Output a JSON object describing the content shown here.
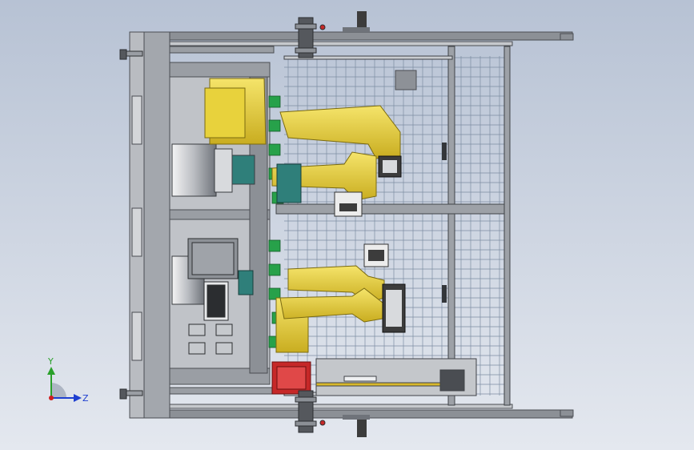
{
  "viewport": {
    "background_top": "#b7c2d4",
    "background_bottom": "#e4e8ef"
  },
  "model": {
    "colors": {
      "frame": "#6f737a",
      "frame_light": "#b9bcc1",
      "rail": "#8c9096",
      "grid": "#7d8da2",
      "robot_yellow": "#e8d23c",
      "robot_shadow": "#b39a1e",
      "robot_dark": "#3c3c3c",
      "teal": "#2f7f7a",
      "green": "#27a14a",
      "red": "#c62828",
      "chrome": "#d8dadd",
      "panel": "#9a9ea4"
    },
    "robots": 2
  },
  "triad": {
    "y_label": "Y",
    "z_label": "Z",
    "y_color": "#2aa02a",
    "z_color": "#1e3fd0",
    "origin_color": "#d01e1e"
  }
}
